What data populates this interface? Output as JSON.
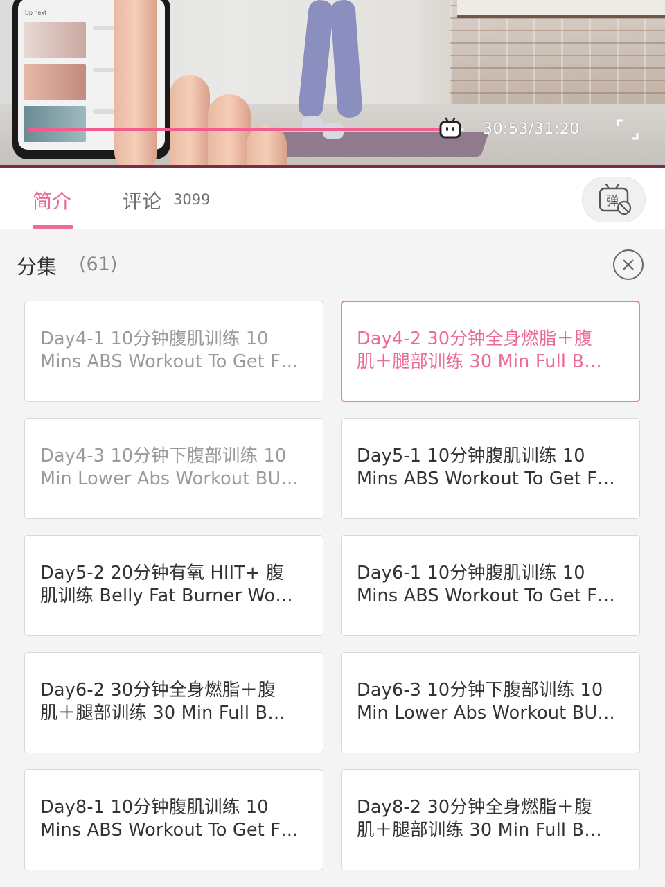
{
  "player": {
    "up_next_label": "Up next",
    "time_readout": "30:53/31:20",
    "progress_fraction": 0.986,
    "accent_color": "#f25d8e"
  },
  "tabs": {
    "intro_label": "简介",
    "comments_label": "评论",
    "comments_count": "3099",
    "danmaku_icon_label": "弹"
  },
  "episodes": {
    "title": "分集",
    "count": "(61)",
    "items": [
      {
        "line1": "Day4-1  10分钟腹肌训练  10",
        "line2": "Mins ABS Workout To Get F…",
        "state": "watched"
      },
      {
        "line1": "Day4-2  30分钟全身燃脂＋腹",
        "line2": "肌＋腿部训练  30 Min Full B…",
        "state": "active"
      },
      {
        "line1": "Day4-3  10分钟下腹部训练 10",
        "line2": "Min Lower Abs Workout BU…",
        "state": "watched"
      },
      {
        "line1": "Day5-1   10分钟腹肌训练 10",
        "line2": "Mins ABS Workout To Get F…",
        "state": "normal"
      },
      {
        "line1": "Day5-2   20分钟有氧 HIIT+ 腹",
        "line2": "肌训练  Belly Fat Burner Wo…",
        "state": "normal"
      },
      {
        "line1": "Day6-1  10分钟腹肌训练  10",
        "line2": "Mins ABS Workout To Get F…",
        "state": "normal"
      },
      {
        "line1": "Day6-2  30分钟全身燃脂＋腹",
        "line2": "肌＋腿部训练   30 Min Full B…",
        "state": "normal"
      },
      {
        "line1": "Day6-3  10分钟下腹部训练 10",
        "line2": "Min Lower Abs Workout BU…",
        "state": "normal"
      },
      {
        "line1": "Day8-1  10分钟腹肌训练 10",
        "line2": "Mins ABS Workout To Get F…",
        "state": "normal"
      },
      {
        "line1": "Day8-2  30分钟全身燃脂＋腹",
        "line2": "肌＋腿部训练  30 Min Full B…",
        "state": "normal"
      }
    ]
  }
}
